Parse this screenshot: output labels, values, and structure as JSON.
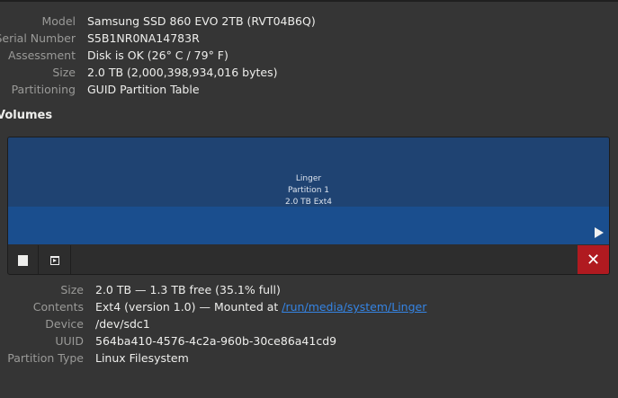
{
  "drive": [
    {
      "label": "Model",
      "value": "Samsung SSD 860 EVO 2TB (RVT04B6Q)"
    },
    {
      "label": "Serial Number",
      "value": "S5B1NR0NA14783R"
    },
    {
      "label": "Assessment",
      "value": "Disk is OK (26° C / 79° F)"
    },
    {
      "label": "Size",
      "value": "2.0 TB (2,000,398,934,016 bytes)"
    },
    {
      "label": "Partitioning",
      "value": "GUID Partition Table"
    }
  ],
  "volumes_heading": "Volumes",
  "partition": {
    "name": "Linger",
    "number": "Partition 1",
    "summary": "2.0 TB Ext4"
  },
  "volume": {
    "size": {
      "label": "Size",
      "value": "2.0 TB — 1.3 TB free (35.1% full)"
    },
    "contents": {
      "label": "Contents",
      "value": "Ext4 (version 1.0) — Mounted at ",
      "link": "/run/media/system/Linger"
    },
    "device": {
      "label": "Device",
      "value": "/dev/sdc1"
    },
    "uuid": {
      "label": "UUID",
      "value": "564ba410-4576-4c2a-960b-30ce86a41cd9"
    },
    "ptype": {
      "label": "Partition Type",
      "value": "Linux Filesystem"
    }
  }
}
